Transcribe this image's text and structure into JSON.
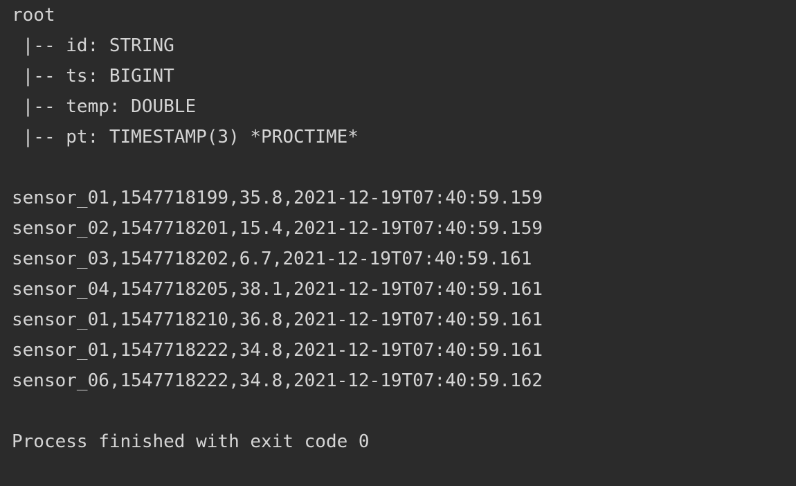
{
  "console": {
    "schema": {
      "root": "root",
      "fields": [
        " |-- id: STRING",
        " |-- ts: BIGINT",
        " |-- temp: DOUBLE",
        " |-- pt: TIMESTAMP(3) *PROCTIME*"
      ]
    },
    "rows": [
      "sensor_01,1547718199,35.8,2021-12-19T07:40:59.159",
      "sensor_02,1547718201,15.4,2021-12-19T07:40:59.159",
      "sensor_03,1547718202,6.7,2021-12-19T07:40:59.161",
      "sensor_04,1547718205,38.1,2021-12-19T07:40:59.161",
      "sensor_01,1547718210,36.8,2021-12-19T07:40:59.161",
      "sensor_01,1547718222,34.8,2021-12-19T07:40:59.161",
      "sensor_06,1547718222,34.8,2021-12-19T07:40:59.162"
    ],
    "exit_message": "Process finished with exit code 0"
  }
}
